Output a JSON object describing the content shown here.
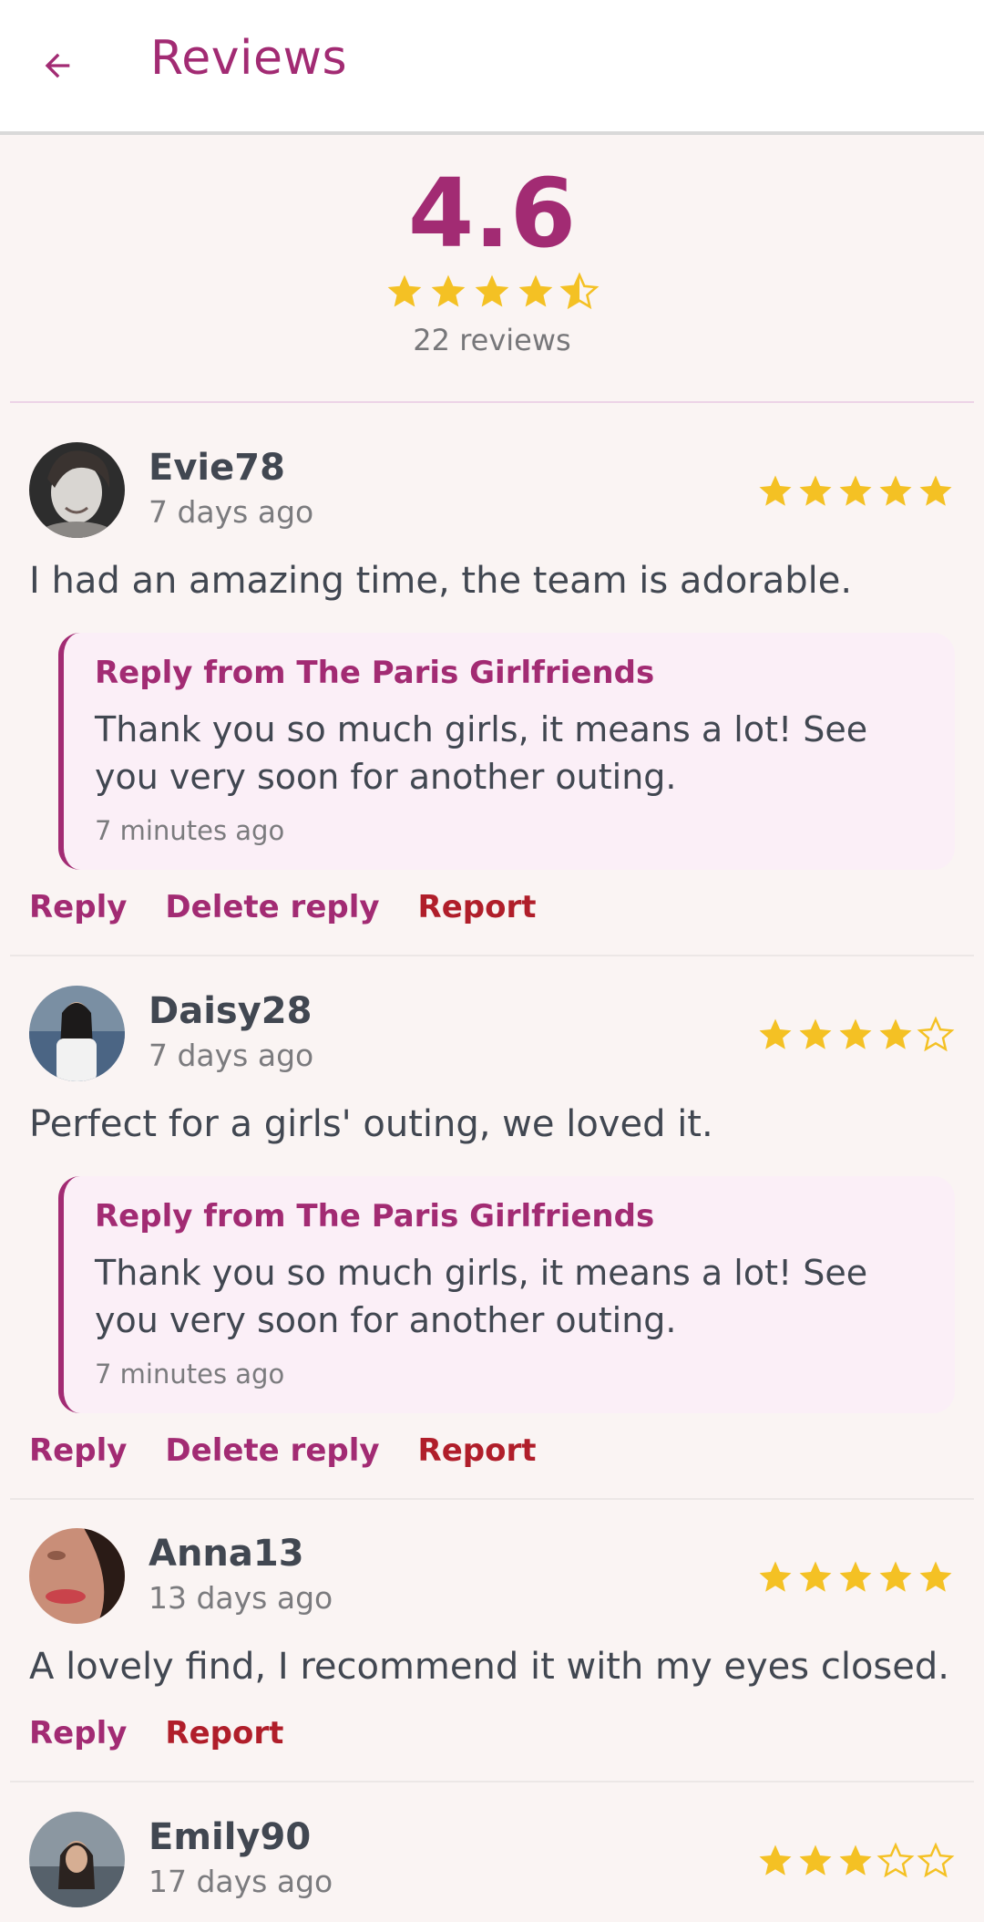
{
  "header": {
    "title": "Reviews",
    "back_icon": "arrow-left-icon"
  },
  "summary": {
    "average": "4.6",
    "rating": 4.5,
    "count_label": "22 reviews"
  },
  "colors": {
    "accent": "#a22b73",
    "star": "#f4c124",
    "danger": "#b01e2a"
  },
  "reviews": [
    {
      "username": "Evie78",
      "date": "7 days ago",
      "rating": 5,
      "text": "I had an amazing time, the team is adorable.",
      "reply": {
        "title": "Reply from The Paris Girlfriends",
        "text": "Thank you so much girls, it means a lot! See you very soon for another outing.",
        "time": "7 minutes ago"
      },
      "actions": [
        "Reply",
        "Delete reply",
        "Report"
      ]
    },
    {
      "username": "Daisy28",
      "date": "7 days ago",
      "rating": 4,
      "text": "Perfect for a girls' outing, we loved it.",
      "reply": {
        "title": "Reply from The Paris Girlfriends",
        "text": "Thank you so much girls, it means a lot! See you very soon for another outing.",
        "time": "7 minutes ago"
      },
      "actions": [
        "Reply",
        "Delete reply",
        "Report"
      ]
    },
    {
      "username": "Anna13",
      "date": "13 days ago",
      "rating": 5,
      "text": "A lovely find, I recommend it with my eyes closed.",
      "actions": [
        "Reply",
        "Report"
      ]
    },
    {
      "username": "Emily90",
      "date": "17 days ago",
      "rating": 3
    }
  ]
}
